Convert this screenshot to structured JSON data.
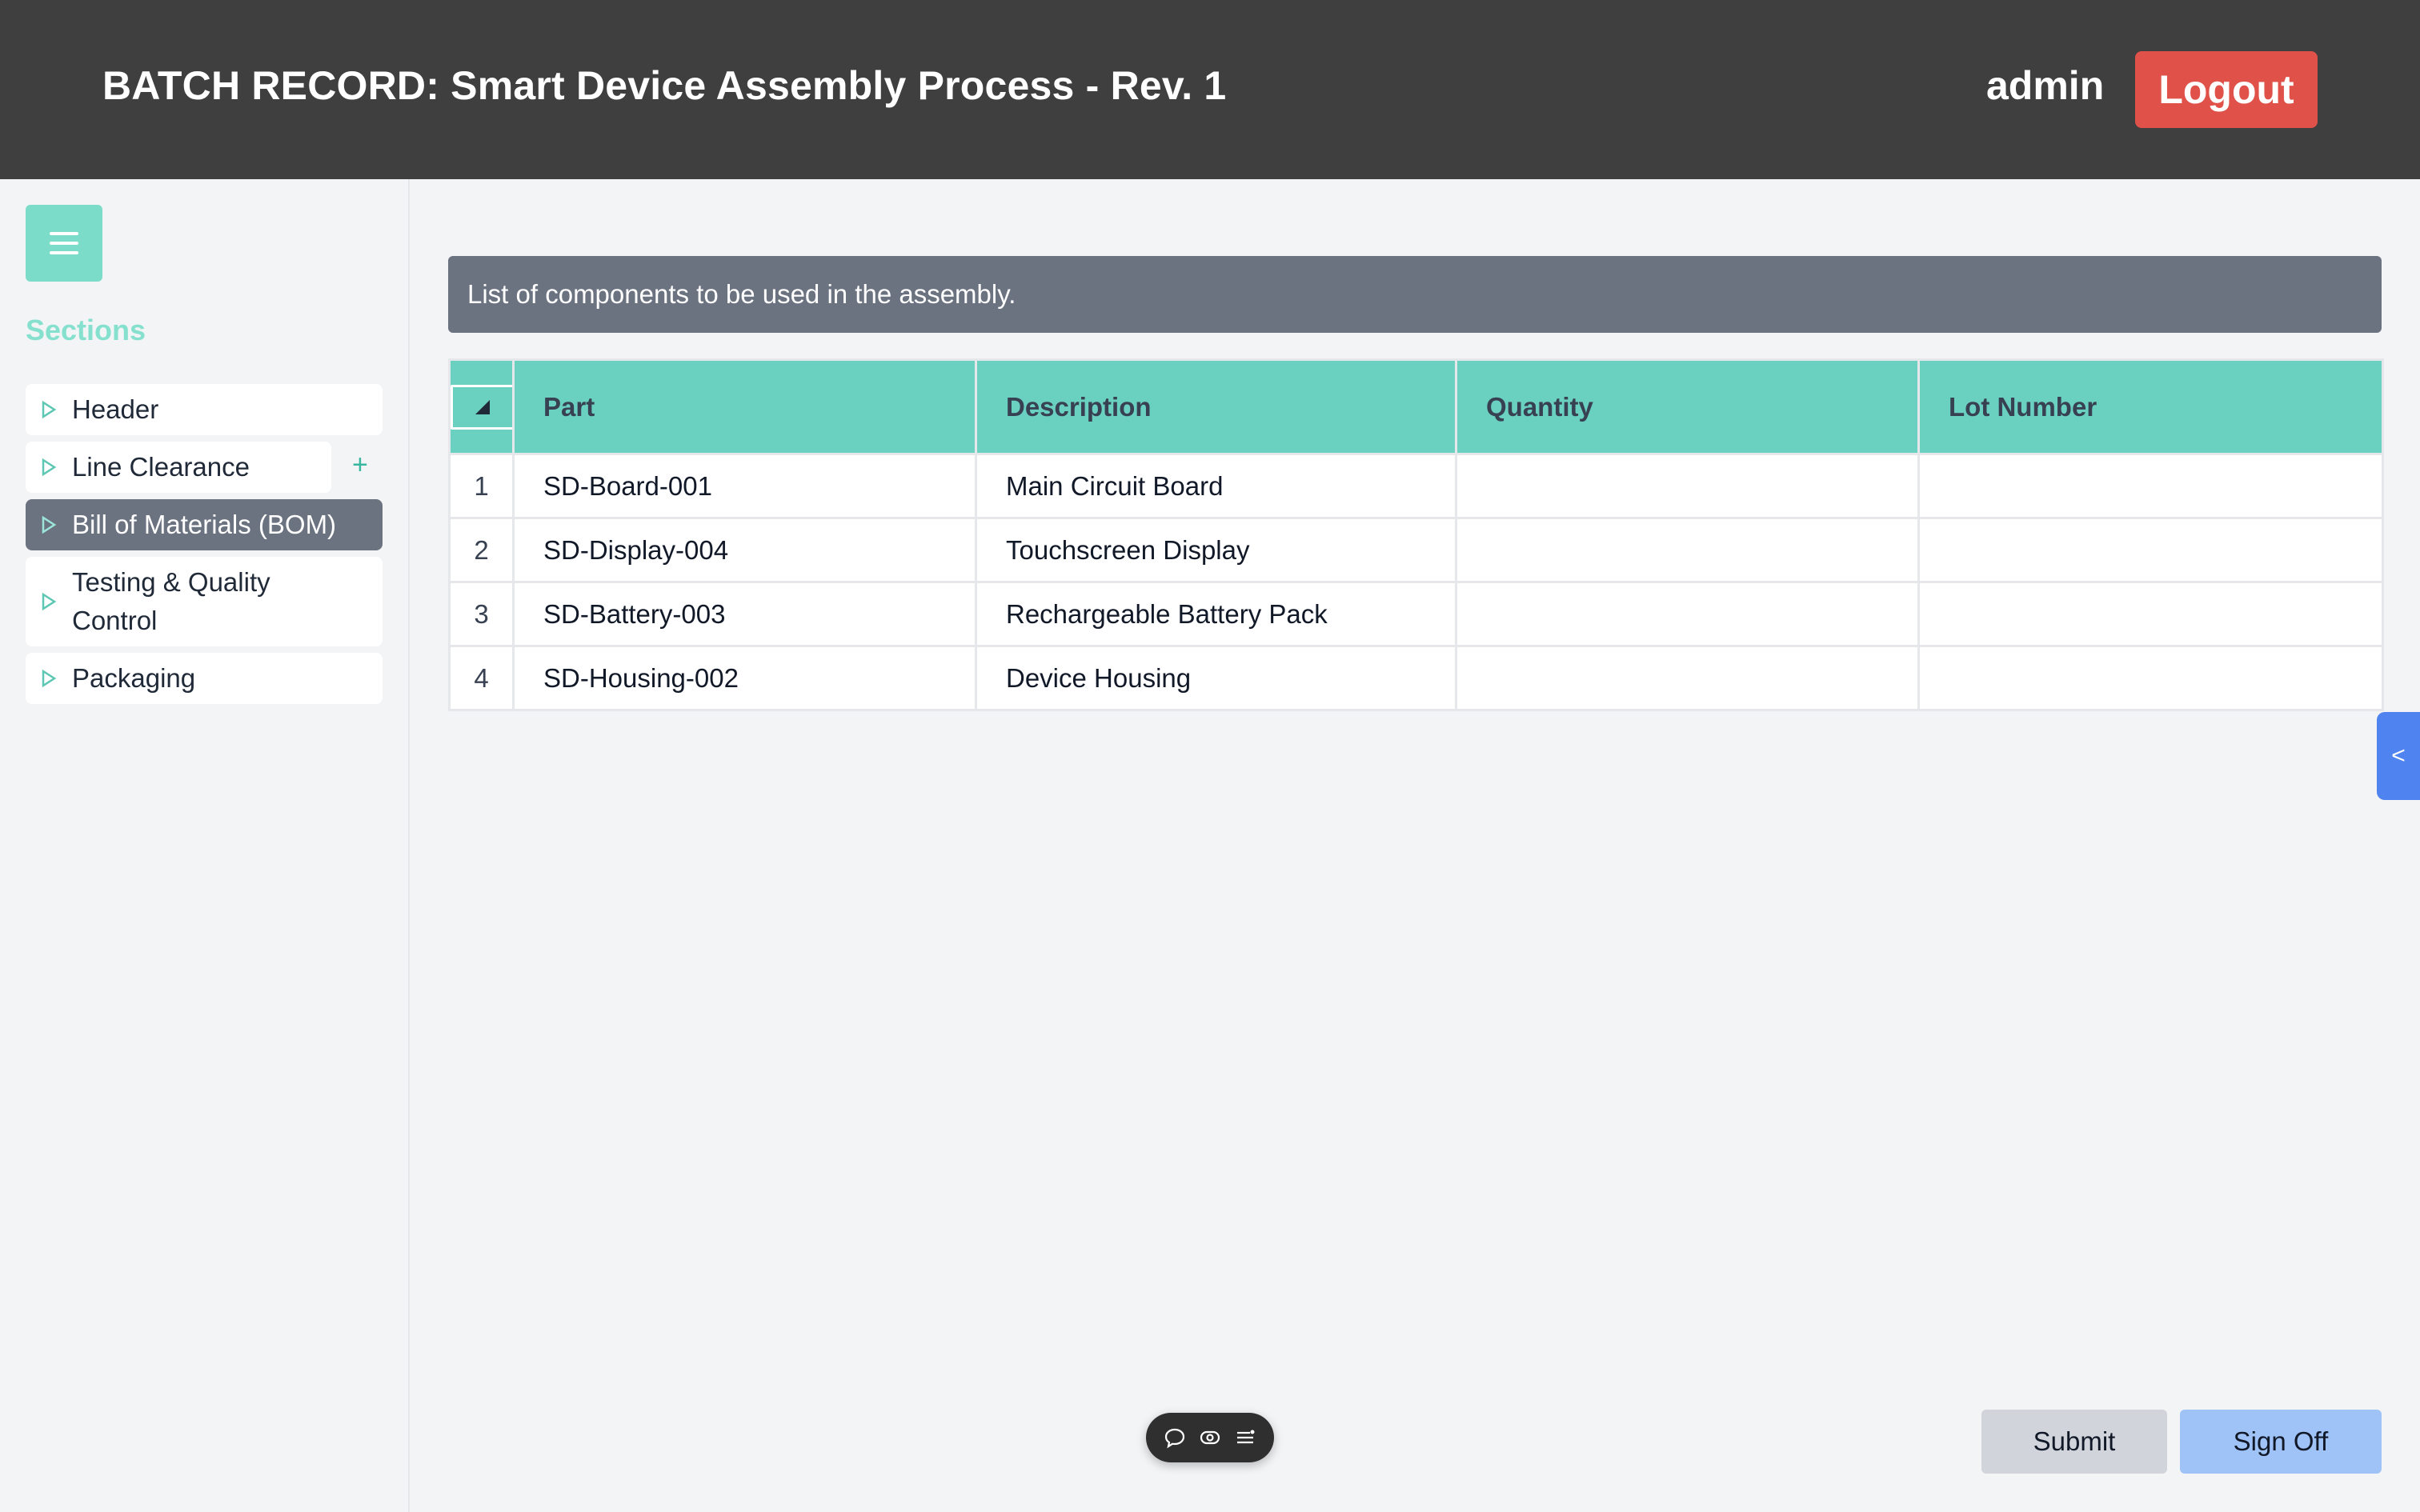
{
  "header": {
    "title": "BATCH RECORD: Smart Device Assembly Process - Rev. 1",
    "user": "admin",
    "logout_label": "Logout"
  },
  "sidebar": {
    "menu_icon": "hamburger-icon",
    "sections_label": "Sections",
    "add_label": "+",
    "items": [
      {
        "label": "Header",
        "active": false
      },
      {
        "label": "Line Clearance",
        "active": false
      },
      {
        "label": "Bill of Materials (BOM)",
        "active": true
      },
      {
        "label": "Testing & Quality Control",
        "active": false
      },
      {
        "label": "Packaging",
        "active": false
      }
    ]
  },
  "main": {
    "description": "List of components to be used in the assembly.",
    "table": {
      "columns": [
        "Part",
        "Description",
        "Quantity",
        "Lot Number"
      ],
      "rows": [
        {
          "num": "1",
          "part": "SD-Board-001",
          "description": "Main Circuit Board",
          "quantity": "",
          "lot": ""
        },
        {
          "num": "2",
          "part": "SD-Display-004",
          "description": "Touchscreen Display",
          "quantity": "",
          "lot": ""
        },
        {
          "num": "3",
          "part": "SD-Battery-003",
          "description": "Rechargeable Battery Pack",
          "quantity": "",
          "lot": ""
        },
        {
          "num": "4",
          "part": "SD-Housing-002",
          "description": "Device Housing",
          "quantity": "",
          "lot": ""
        }
      ]
    }
  },
  "side_tab_label": "<",
  "toolbar": {
    "icons": [
      "comment-icon",
      "eye-icon",
      "list-icon"
    ]
  },
  "actions": {
    "submit_label": "Submit",
    "signoff_label": "Sign Off"
  },
  "colors": {
    "header_bg": "#3f3f3f",
    "logout": "#df5149",
    "accent": "#6ad1c0",
    "active_nav": "#6b7280",
    "side_tab": "#4f83f0",
    "signoff": "#9fc3f7"
  }
}
